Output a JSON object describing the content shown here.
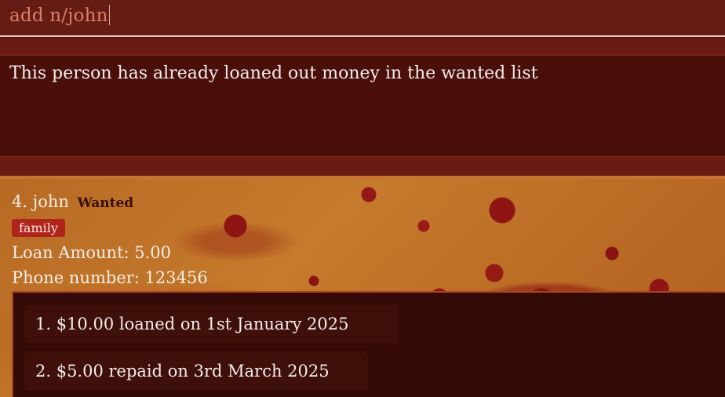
{
  "command": {
    "value": "add n/john"
  },
  "result": {
    "message": "This person has already loaned out money in the wanted list"
  },
  "person": {
    "index_name": "4. john",
    "status": "Wanted",
    "tag": "family",
    "loan_amount": "Loan Amount: 5.00",
    "phone": "Phone number: 123456",
    "transactions": [
      {
        "text": "1. $10.00 loaned on 1st January 2025"
      },
      {
        "text": "2. $5.00 repaid on 3rd March 2025"
      }
    ]
  },
  "colors": {
    "command_bg": "#651c14",
    "result_bg": "#4b0f09",
    "tag_bg": "#b0241c"
  }
}
